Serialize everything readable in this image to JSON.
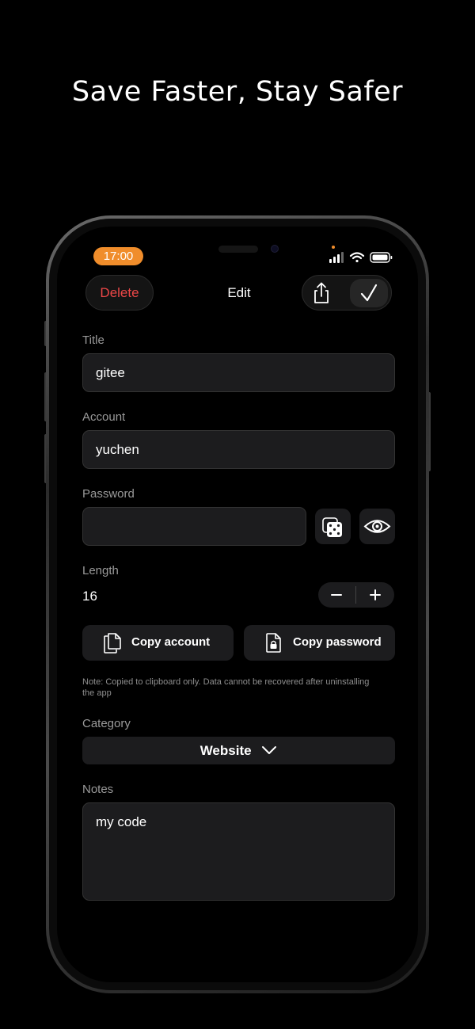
{
  "headline": "Save Faster, Stay Safer",
  "status_bar": {
    "time": "17:00"
  },
  "nav": {
    "delete_label": "Delete",
    "title": "Edit"
  },
  "form": {
    "title_label": "Title",
    "title_value": "gitee",
    "account_label": "Account",
    "account_value": "yuchen",
    "password_label": "Password",
    "password_value": "",
    "length_label": "Length",
    "length_value": "16",
    "copy_account_label": "Copy account",
    "copy_password_label": "Copy password",
    "note": "Note: Copied to clipboard only. Data cannot be recovered after uninstalling the app",
    "category_label": "Category",
    "category_value": "Website",
    "notes_label": "Notes",
    "notes_value": "my code"
  },
  "colors": {
    "accent_orange": "#f08d2b",
    "delete_red": "#ec4747",
    "field_bg": "#1c1c1e"
  }
}
